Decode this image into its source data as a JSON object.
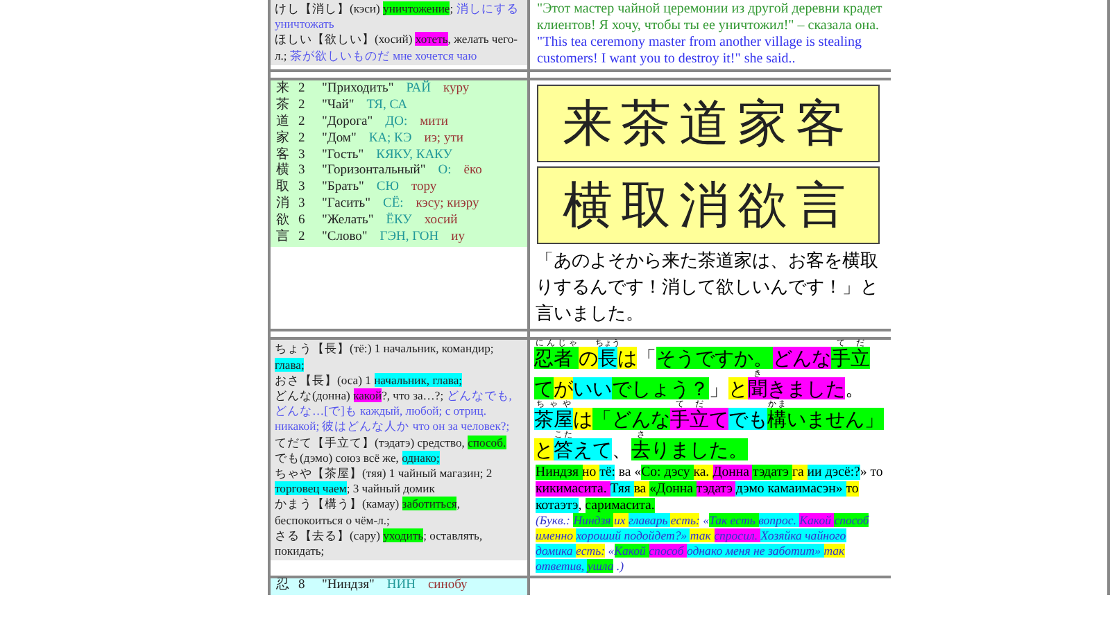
{
  "entries_top": [
    [
      {
        "text": "けし【消し】(кэси) "
      },
      {
        "text": "уничтожение",
        "color": "#00ff00"
      },
      {
        "text": "; "
      },
      {
        "text": "消しにする уничтожать",
        "kind": "example"
      }
    ],
    [
      {
        "text": "ほしい【欲しい】(хосий) "
      },
      {
        "text": "хотеть",
        "color": "#ff00ff"
      },
      {
        "text": ", желать чего-л.; "
      },
      {
        "text": "茶が欲しいものだ мне хочется чаю",
        "kind": "example"
      }
    ]
  ],
  "story_ru": "\"Этот мастер чайной церемонии из другой деревни крадет клиентов! Я хочу, чтобы ты ее уничтожил!\" – сказала она.",
  "story_en": "\"This tea ceremony master from another village is stealing customers! I want you to destroy it!\" she said..",
  "kanji_table": [
    {
      "kanji": "来",
      "strokes": "2",
      "meaning": "\"Приходить\"",
      "on": "РАЙ",
      "kun": "куру"
    },
    {
      "kanji": "茶",
      "strokes": "2",
      "meaning": "\"Чай\"",
      "on": "ТЯ, СА"
    },
    {
      "kanji": "道",
      "strokes": "2",
      "meaning": "\"Дорога\"",
      "on": "ДО:",
      "kun": "мити"
    },
    {
      "kanji": "家",
      "strokes": "2",
      "meaning": "\"Дом\"",
      "on": "КА; КЭ",
      "kun": "иэ; ути"
    },
    {
      "kanji": "客",
      "strokes": "3",
      "meaning": "\"Гость\"",
      "on": "КЯКУ, КАКУ"
    },
    {
      "kanji": "横",
      "strokes": "3",
      "meaning": "\"Горизонтальный\"",
      "on": "О:",
      "kun": "ёко"
    },
    {
      "kanji": "取",
      "strokes": "3",
      "meaning": "\"Брать\"",
      "on": "СЮ",
      "kun": "тору"
    },
    {
      "kanji": "消",
      "strokes": "3",
      "meaning": "\"Гасить\"",
      "on": "СЁ:",
      "kun": "кэсу; киэру"
    },
    {
      "kanji": "欲",
      "strokes": "6",
      "meaning": "\"Желать\"",
      "on": "ЁКУ",
      "kun": "хосий"
    },
    {
      "kanji": "言",
      "strokes": "2",
      "meaning": "\"Слово\"",
      "on": "ГЭН, ГОН",
      "kun": "иу"
    }
  ],
  "kanji_boxes": [
    "来茶道家客",
    "横取消欲言"
  ],
  "passage_ja": "「あのよそから来た茶道家は、お客を横取りするんです！消して欲しいんです！」と言いました。",
  "entries_bottom": [
    [
      {
        "text": "ちょう【長】(тё:) 1 начальник, командир; "
      },
      {
        "text": "глава;",
        "color": "#00ffff"
      }
    ],
    [
      {
        "text": "おさ【長】(оса) 1 "
      },
      {
        "text": "начальник, глава;",
        "color": "#00ffff"
      }
    ],
    [
      {
        "text": "どんな(донна) "
      },
      {
        "text": "какой",
        "color": "#ff00ff"
      },
      {
        "text": "?, что за…?; "
      },
      {
        "text": "どんなでも, どんな…[で]も каждый, любой; с отриц. никакой; 彼はどんな人か что он за человек?;",
        "kind": "example"
      }
    ],
    [
      {
        "text": "てだて【手立て】(тэдатэ) средство, "
      },
      {
        "text": "способ.",
        "color": "#00ff00"
      }
    ],
    [
      {
        "text": "でも(дэмо) союз всё же, "
      },
      {
        "text": "однако;",
        "color": "#00ffff"
      }
    ],
    [
      {
        "text": "ちゃや【茶屋】(тяя) 1 чайный магазин; 2 "
      },
      {
        "text": "торговец чаем",
        "color": "#00ffff"
      },
      {
        "text": "; 3 чайный домик"
      }
    ],
    [
      {
        "text": "かまう【構う】(камау) "
      },
      {
        "text": "заботиться",
        "color": "#00ff00"
      },
      {
        "text": ", беспокоиться о чём-л.;"
      }
    ],
    [
      {
        "text": "さる【去る】(сару) "
      },
      {
        "text": "уходить",
        "color": "#00ff00"
      },
      {
        "text": "; оставлять, покидать;"
      }
    ]
  ],
  "passage_annotated": [
    {
      "text": "忍者 ",
      "ruby": "にんじゃ",
      "color": "#00ff00"
    },
    {
      "text": "の",
      "color": "#ffff00"
    },
    {
      "text": "長",
      "ruby": "ちょう",
      "color": "#00ffff"
    },
    {
      "text": "は",
      "color": "#ffff00"
    },
    {
      "text": "「"
    },
    {
      "text": "そうですか。",
      "color": "#00ff00"
    },
    {
      "text": "どんな",
      "color": "#ff00ff"
    },
    {
      "text": "手立",
      "ruby": "てだ",
      "color": "#00ff00"
    },
    {
      "text": "て",
      "color": "#00ff00"
    },
    {
      "text": "が",
      "color": "#ffff00"
    },
    {
      "text": "いい",
      "color": "#00ffff"
    },
    {
      "text": "でしょう？",
      "color": "#00ff00"
    },
    {
      "text": "」"
    },
    {
      "text": "と",
      "color": "#ffff00"
    },
    {
      "text": "聞",
      "ruby": "き",
      "color": "#ff00ff"
    },
    {
      "text": "きました",
      "color": "#ff00ff"
    },
    {
      "text": "。"
    },
    {
      "text": "茶屋",
      "ruby": "ちゃや",
      "color": "#00ffff"
    },
    {
      "text": "は",
      "color": "#ffff00"
    },
    {
      "text": "「どんな",
      "color": "#00ff00"
    },
    {
      "text": "手立",
      "ruby": "てだ",
      "color": "#ff00ff"
    },
    {
      "text": "て",
      "color": "#ff00ff"
    },
    {
      "text": "でも",
      "color": "#00ffff"
    },
    {
      "text": "構",
      "ruby": "かま",
      "color": "#00ff00"
    },
    {
      "text": "いません」",
      "color": "#00ff00"
    },
    {
      "text": "と",
      "color": "#ffff00"
    },
    {
      "text": "答",
      "ruby": "こた",
      "color": "#00ffff"
    },
    {
      "text": "えて",
      "color": "#00ffff"
    },
    {
      "text": "、"
    },
    {
      "text": "去",
      "ruby": "さ",
      "color": "#00ff00"
    },
    {
      "text": "りました。",
      "color": "#00ff00"
    }
  ],
  "transliteration": [
    {
      "text": "Ниндзя ",
      "color": "#00ff00"
    },
    {
      "text": "но ",
      "color": "#ffff00"
    },
    {
      "text": "тё:",
      "color": "#00ffff"
    },
    {
      "text": " ва «"
    },
    {
      "text": "Со: дэсу ",
      "color": "#00ff00"
    },
    {
      "text": "ка. ",
      "color": "#ffff00"
    },
    {
      "text": "Донна ",
      "color": "#ff00ff"
    },
    {
      "text": "тэдатэ ",
      "color": "#00ff00"
    },
    {
      "text": "га ",
      "color": "#ffff00"
    },
    {
      "text": "ии дэсё:?",
      "color": "#00ffff"
    },
    {
      "text": "» то "
    },
    {
      "text": "кикимасита. ",
      "color": "#ff00ff"
    },
    {
      "text": "Тяя ",
      "color": "#00ffff"
    },
    {
      "text": "ва ",
      "color": "#ffff00"
    },
    {
      "text": "«Донна ",
      "color": "#00ff00"
    },
    {
      "text": "тэдатэ ",
      "color": "#ff00ff"
    },
    {
      "text": "дэмо камаимасэн» ",
      "color": "#00ffff"
    },
    {
      "text": "то ",
      "color": "#ffff00"
    },
    {
      "text": "котаэтэ",
      "color": "#00ffff"
    },
    {
      "text": ", "
    },
    {
      "text": "саримасита.",
      "color": "#00ff00"
    }
  ],
  "literal_translation": [
    {
      "text": "(Букв.: "
    },
    {
      "text": "Ниндзя ",
      "color": "#00ff00"
    },
    {
      "text": "их ",
      "color": "#ffff00"
    },
    {
      "text": "главарь ",
      "color": "#00ffff"
    },
    {
      "text": "есть:",
      "color": "#ffff00"
    },
    {
      "text": " «"
    },
    {
      "text": "Так есть ",
      "color": "#00ff00"
    },
    {
      "text": "вопрос. ",
      "color": "#00ffff"
    },
    {
      "text": "Какой ",
      "color": "#ff00ff"
    },
    {
      "text": "способ ",
      "color": "#00ff00"
    },
    {
      "text": "именно ",
      "color": "#ffff00"
    },
    {
      "text": "хороший подойдет?» ",
      "color": "#00ffff"
    },
    {
      "text": "так ",
      "color": "#ffff00"
    },
    {
      "text": "спросил. ",
      "color": "#ff00ff"
    },
    {
      "text": "Хозяйка чайного домика ",
      "color": "#00ffff"
    },
    {
      "text": "есть:",
      "color": "#ffff00"
    },
    {
      "text": " «"
    },
    {
      "text": "Какой ",
      "color": "#00ff00"
    },
    {
      "text": "способ ",
      "color": "#ff00ff"
    },
    {
      "text": "однако меня не заботит» ",
      "color": "#00ffff"
    },
    {
      "text": "так ",
      "color": "#ffff00"
    },
    {
      "text": "ответив, ",
      "color": "#00ffff"
    },
    {
      "text": "ушла",
      "color": "#00ff00"
    },
    {
      "text": " .)"
    }
  ],
  "next_kanji": {
    "kanji": "忍",
    "strokes": "8",
    "meaning": "\"Ниндзя\"",
    "on": "НИН",
    "kun": "синобу"
  }
}
